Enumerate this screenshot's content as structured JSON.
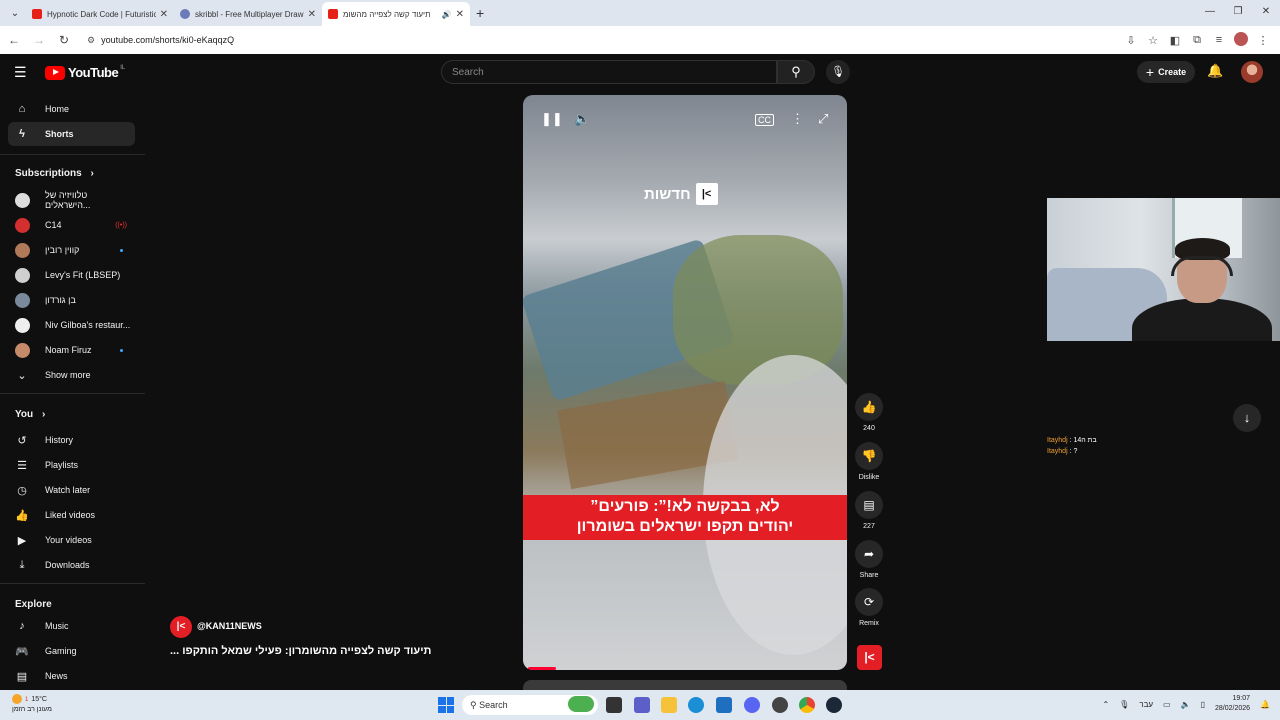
{
  "browser": {
    "tabs": [
      {
        "title": "Hypnotic Dark Code | Futuristic",
        "active": false,
        "color": "#e62117"
      },
      {
        "title": "skribbl - Free Multiplayer Draw",
        "active": false,
        "color": "#6b7ab8"
      },
      {
        "title": "תיעוד קשה לצפייה מהשומ",
        "active": true,
        "color": "#e62117"
      }
    ],
    "url": "youtube.com/shorts/ki0-eKaqqzQ"
  },
  "header": {
    "logo_text": "YouTube",
    "region": "IL",
    "search_placeholder": "Search",
    "create_label": "Create"
  },
  "sidebar": {
    "main": [
      {
        "label": "Home",
        "icon": "home-icon",
        "glyph": "⌂"
      },
      {
        "label": "Shorts",
        "icon": "shorts-icon",
        "glyph": "ϟ"
      }
    ],
    "subscriptions_heading": "Subscriptions",
    "subscriptions": [
      {
        "label": "טלוויזיה של הישראלים...",
        "color": "#ddd",
        "dot": false
      },
      {
        "label": "C14",
        "color": "#d32f2f",
        "dot": false,
        "live": true
      },
      {
        "label": "קווין רובין",
        "color": "#b07a5a",
        "dot": true
      },
      {
        "label": "Levy's Fit (LBSEP)",
        "color": "#cfcfcf",
        "dot": false
      },
      {
        "label": "בן גורדון",
        "color": "#7b8a9a",
        "dot": false
      },
      {
        "label": "Niv Gilboa's restaur...",
        "color": "#eeeeee",
        "dot": false
      },
      {
        "label": "Noam Firuz",
        "color": "#c48a6a",
        "dot": true
      }
    ],
    "show_more": "Show more",
    "you_heading": "You",
    "you_items": [
      {
        "label": "History",
        "glyph": "↺"
      },
      {
        "label": "Playlists",
        "glyph": "☰"
      },
      {
        "label": "Watch later",
        "glyph": "◷"
      },
      {
        "label": "Liked videos",
        "glyph": "👍"
      },
      {
        "label": "Your videos",
        "glyph": "▶"
      },
      {
        "label": "Downloads",
        "glyph": "⤓"
      }
    ],
    "explore_heading": "Explore",
    "explore_items": [
      {
        "label": "Music",
        "glyph": "♪"
      },
      {
        "label": "Gaming",
        "glyph": "🎮"
      },
      {
        "label": "News",
        "glyph": "▤"
      }
    ]
  },
  "short": {
    "news_tag": "חדשות",
    "banner_line1": "”לא, בבקשה לא!”: פורעים",
    "banner_line2": "יהודים תקפו ישראלים בשומרון",
    "channel": "@KAN11NEWS",
    "title": "... תיעוד קשה לצפייה מהשומרון: פעילי שמאל הותקפו",
    "progress": 0.09,
    "actions": {
      "likes": "240",
      "dislike": "Dislike",
      "comments": "227",
      "share": "Share",
      "remix": "Remix"
    }
  },
  "chat": [
    {
      "user": "Itayhdj",
      "msg": ": בת ה14"
    },
    {
      "user": "Itayhdj",
      "msg": ": ?"
    }
  ],
  "taskbar": {
    "temp": "15°C",
    "weather_text": "מעונן רב הזמן",
    "search": "Search",
    "lang": "עבר",
    "time": "19:07",
    "date": "28/02/2026",
    "weather_badge": "1"
  }
}
